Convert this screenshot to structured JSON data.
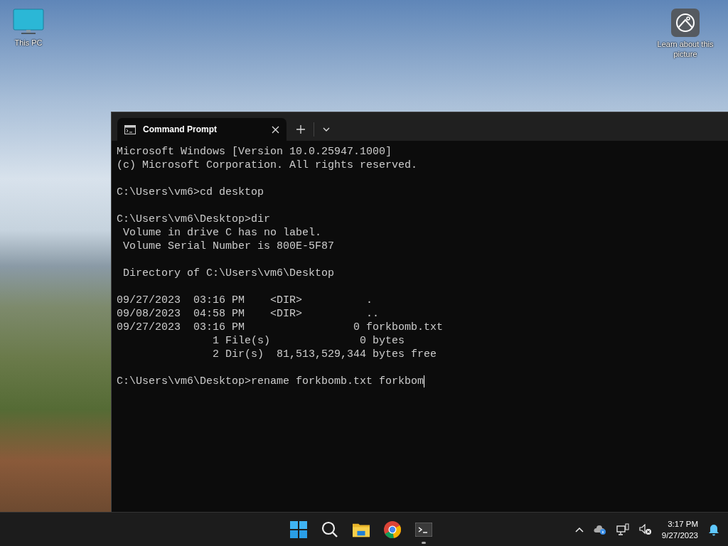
{
  "desktop_icons": [
    {
      "kind": "computer",
      "label": "This PC"
    },
    {
      "kind": "picture-info",
      "label": "Learn about this picture"
    }
  ],
  "terminal": {
    "tabs": [
      {
        "title": "Command Prompt",
        "selected": true
      }
    ],
    "blocks": [
      [
        "Microsoft Windows [Version 10.0.25947.1000]",
        "(c) Microsoft Corporation. All rights reserved."
      ],
      [
        "C:\\Users\\vm6>cd desktop"
      ],
      [
        "C:\\Users\\vm6\\Desktop>dir",
        " Volume in drive C has no label.",
        " Volume Serial Number is 800E-5F87"
      ],
      [
        " Directory of C:\\Users\\vm6\\Desktop"
      ],
      [
        "09/27/2023  03:16 PM    <DIR>          .",
        "09/08/2023  04:58 PM    <DIR>          ..",
        "09/27/2023  03:16 PM                 0 forkbomb.txt",
        "               1 File(s)              0 bytes",
        "               2 Dir(s)  81,513,529,344 bytes free"
      ]
    ],
    "input_line": "C:\\Users\\vm6\\Desktop>rename forkbomb.txt forkbom"
  },
  "taskbar": {
    "apps": [
      {
        "kind": "start",
        "running": false
      },
      {
        "kind": "search",
        "running": false
      },
      {
        "kind": "folder",
        "running": false
      },
      {
        "kind": "browser",
        "running": false
      },
      {
        "kind": "terminal",
        "running": true
      }
    ],
    "tray": [
      {
        "kind": "chevron"
      },
      {
        "kind": "cloud"
      },
      {
        "kind": "network"
      },
      {
        "kind": "volume"
      }
    ],
    "time": "3:17 PM",
    "date": "9/27/2023"
  }
}
